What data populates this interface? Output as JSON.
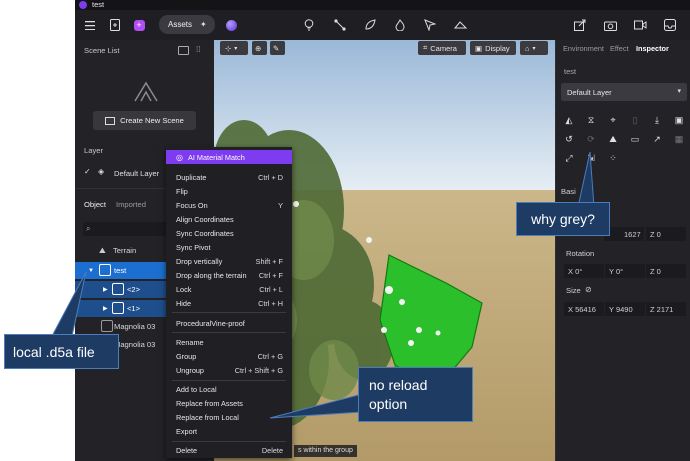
{
  "window": {
    "title": "test"
  },
  "toolbar": {
    "assets_label": "Assets"
  },
  "left_panel": {
    "scene_list_title": "Scene List",
    "create_scene_label": "Create New Scene",
    "layer_title": "Layer",
    "default_layer": "Default Layer",
    "tabs": [
      "Object",
      "Imported"
    ],
    "tree": {
      "terrain": "Terrain",
      "test": "test",
      "child1": "<2>",
      "child2": "<1>",
      "magnolia1": "Magnolia 03",
      "magnolia2": "Magnolia 03"
    }
  },
  "viewport": {
    "camera_label": "Camera",
    "display_label": "Display",
    "hint_text": "s within the group"
  },
  "context_menu": {
    "ai_label": "AI Material Match",
    "items": [
      {
        "label": "Duplicate",
        "shortcut": "Ctrl + D"
      },
      {
        "label": "Flip",
        "shortcut": ""
      },
      {
        "label": "Focus On",
        "shortcut": "Y"
      },
      {
        "label": "Align Coordinates",
        "shortcut": ""
      },
      {
        "label": "Sync Coordinates",
        "shortcut": ""
      },
      {
        "label": "Sync Pivot",
        "shortcut": ""
      },
      {
        "label": "Drop vertically",
        "shortcut": "Shift + F"
      },
      {
        "label": "Drop along the terrain",
        "shortcut": "Ctrl + F"
      },
      {
        "label": "Lock",
        "shortcut": "Ctrl + L"
      },
      {
        "label": "Hide",
        "shortcut": "Ctrl + H"
      },
      {
        "label": "ProceduralVine-proof",
        "shortcut": ""
      },
      {
        "label": "Rename",
        "shortcut": ""
      },
      {
        "label": "Group",
        "shortcut": "Ctrl + G"
      },
      {
        "label": "Ungroup",
        "shortcut": "Ctrl + Shift + G"
      },
      {
        "label": "Add to Local",
        "shortcut": ""
      },
      {
        "label": "Replace from Assets",
        "shortcut": ""
      },
      {
        "label": "Replace from Local",
        "shortcut": ""
      },
      {
        "label": "Export",
        "shortcut": ""
      },
      {
        "label": "Delete",
        "shortcut": "Delete"
      }
    ]
  },
  "right_panel": {
    "tabs": [
      "Environment",
      "Effect",
      "Inspector"
    ],
    "object_name": "test",
    "layer_select": "Default Layer",
    "basic_title": "Basi",
    "position": {
      "z": "Z 0",
      "y": "1627"
    },
    "rotation_title": "Rotation",
    "rotation": {
      "x": "X 0°",
      "y": "Y 0°",
      "z": "Z 0"
    },
    "size_title": "Size",
    "size": {
      "x": "X 56416",
      "y": "Y 9490",
      "z": "Z 2171"
    }
  },
  "annotations": {
    "why_grey": "why grey?",
    "local_file": "local .d5a file",
    "no_reload": "no reload option"
  },
  "colors": {
    "accent_purple": "#7d3cf0",
    "selection_blue": "#1c6fd0",
    "callout_fill": "#1e3b63",
    "callout_border": "#4b7cbc"
  }
}
